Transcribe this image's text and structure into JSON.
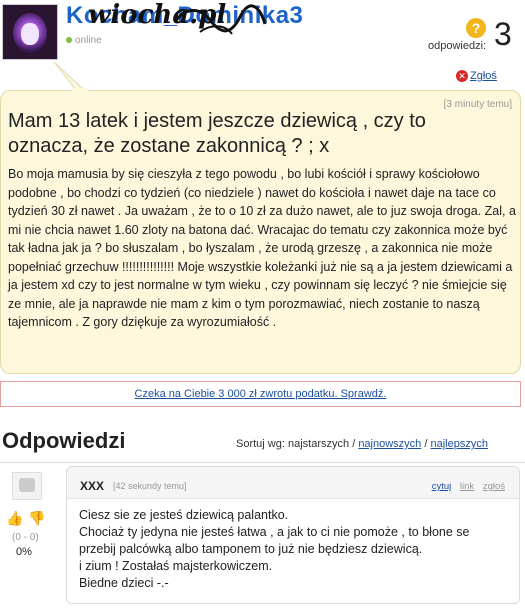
{
  "header": {
    "username": "Kocham_Dominika3",
    "watermark": "wiocha.pl",
    "status": "online",
    "answers_label": "odpowiedzi:",
    "answers_count": "3",
    "report": "Zgłoś"
  },
  "question": {
    "time": "[3 minuty temu]",
    "title": "Mam 13 latek i jestem jeszcze dziewicą , czy to oznacza, że zostane zakonnicą ? ; x",
    "body": "Bo moja mamusia by się cieszyła z tego powodu , bo lubi kościół i sprawy kościołowo podobne , bo chodzi co tydzień (co niedziele ) nawet do kościoła i nawet daje na tace co tydzień 30 zł nawet . Ja uważam , że to o 10 zł za dużo nawet, ale to juz swoja droga. Zal, a mi nie chcia nawet 1.60 zloty na batona dać. Wracajac do tematu czy zakonnica może być tak ładna jak ja ? bo słuszalam , bo łyszalam , że urodą grzeszę , a zakonnica nie może popełniać grzechuw !!!!!!!!!!!!!!! Moje wszystkie koleżanki już nie są a ja jestem dziewicami a ja jestem xd czy to jest normalne w tym wieku , czy powinnam się leczyć ? nie śmiejcie się ze mnie, ale ja naprawde nie mam z kim o tym porozmawiać, niech zostanie to naszą tajemnicom . Z gory dziękuje za wyrozumiałość ."
  },
  "ad": {
    "text": "Czeka na Ciebie 3 000 zł zwrotu podatku. Sprawdź."
  },
  "answers_section": {
    "title": "Odpowiedzi",
    "sort_label": "Sortuj wg:",
    "sort_oldest": "najstarszych",
    "sort_newest": "najnowszych",
    "sort_best": "najlepszych",
    "sep": "/"
  },
  "answer": {
    "user": "XXX",
    "time": "[42 sekundy temu]",
    "actions": {
      "quote": "cytuj",
      "link": "link",
      "report": "zgłoś"
    },
    "votes": "(0 - 0)",
    "percent": "0%",
    "lines": [
      "Ciesz sie ze jesteś dziewicą palantko.",
      "Chociaż ty jedyna nie jesteś łatwa , a jak to ci nie pomoże , to błone se przebij palcówką albo tamponem to już nie będziesz dziewicą.",
      "i zium ! Zostałaś majsterkowiczem.",
      "Biedne dzieci -.-"
    ]
  },
  "icons": {
    "question": "question-mark-icon",
    "report": "report-x-icon",
    "thumb_up": "thumb-up-icon",
    "thumb_down": "thumb-down-icon"
  },
  "colors": {
    "accent_link": "#1e50a0",
    "question_bg": "#fdf7dc",
    "online": "#7cbf3a",
    "report": "#d62a2a",
    "question_icon": "#f2b61b"
  }
}
